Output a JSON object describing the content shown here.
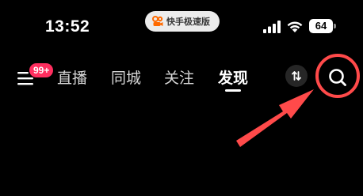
{
  "status_bar": {
    "time": "13:52",
    "app_name": "快手极速版",
    "battery": "64",
    "icons": [
      "cellular-signal-icon",
      "wifi-icon",
      "battery-icon"
    ]
  },
  "nav": {
    "badge": "99+",
    "tabs": [
      {
        "label": "直播"
      },
      {
        "label": "同城"
      },
      {
        "label": "关注"
      },
      {
        "label": "发现",
        "active": true
      }
    ],
    "icons": [
      "menu-icon",
      "swap-icon",
      "search-icon"
    ]
  },
  "annotation": {
    "color": "#ff4a4a"
  },
  "colors": {
    "background": "#000000",
    "badge": "#ff2e5f",
    "annotation": "#ff4a4a"
  }
}
